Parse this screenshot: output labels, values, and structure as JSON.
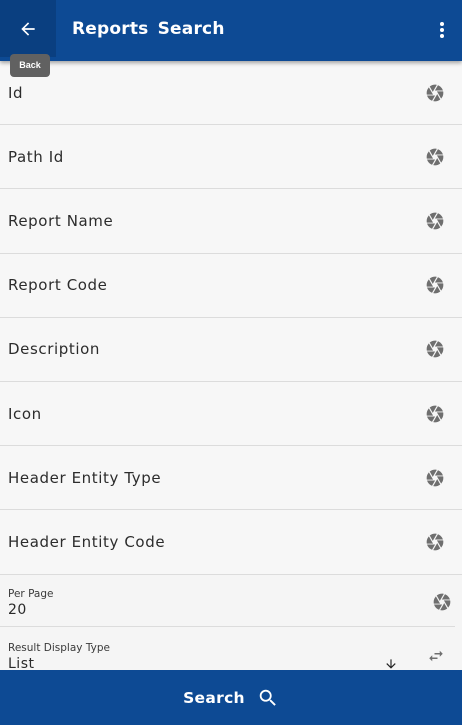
{
  "appbar": {
    "title": "Reports  Search",
    "back_tooltip": "Back",
    "back_icon": "arrow-left-icon",
    "menu_icon": "more-vert-icon"
  },
  "fields": [
    {
      "label": "Id",
      "icon": "aperture-icon"
    },
    {
      "label": "Path Id",
      "icon": "aperture-icon"
    },
    {
      "label": "Report Name",
      "icon": "aperture-icon"
    },
    {
      "label": "Report Code",
      "icon": "aperture-icon"
    },
    {
      "label": "Description",
      "icon": "aperture-icon"
    },
    {
      "label": "Icon",
      "icon": "aperture-icon"
    },
    {
      "label": "Header Entity Type",
      "icon": "aperture-icon"
    },
    {
      "label": "Header Entity Code",
      "icon": "aperture-icon"
    }
  ],
  "per_page": {
    "label": "Per Page",
    "value": "20"
  },
  "result_display": {
    "label": "Result Display Type",
    "value": "List"
  },
  "bottom": {
    "search_label": "Search"
  },
  "colors": {
    "primary": "#0d4a94",
    "background": "#f7f7f7",
    "icon_gray": "#6f6f6f"
  }
}
